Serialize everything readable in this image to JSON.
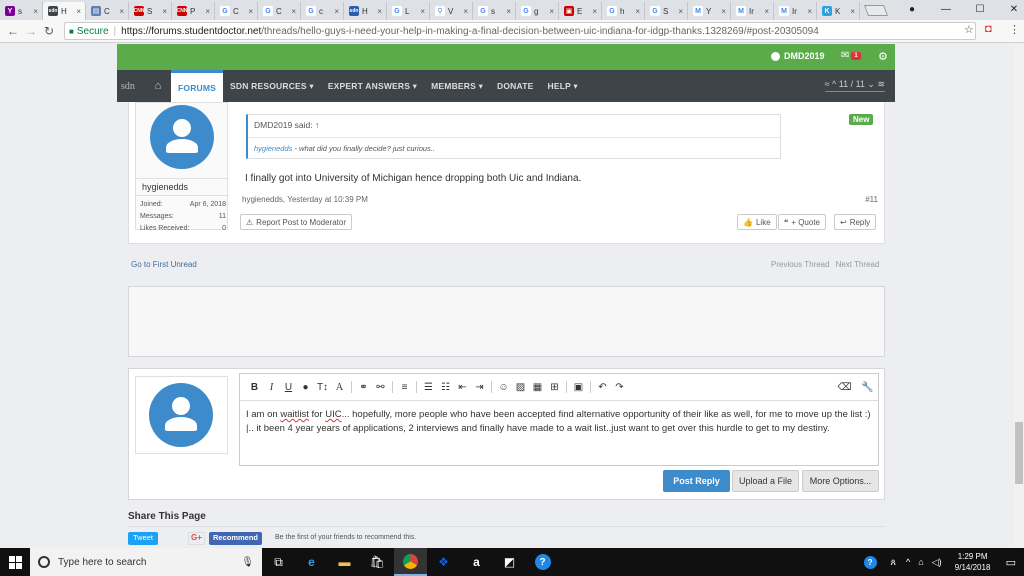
{
  "browser": {
    "tabs": [
      {
        "favicon_text": "Y",
        "favicon_color": "#7b0099",
        "label": "s",
        "close": "×"
      },
      {
        "favicon_text": "sdn",
        "favicon_color": "#3e4447",
        "label": "H",
        "close": "×",
        "active": true
      },
      {
        "favicon_text": "▤",
        "favicon_color": "#5b7fb5",
        "label": "C",
        "close": "×"
      },
      {
        "favicon_text": "CNN",
        "favicon_color": "#cc0000",
        "label": "S",
        "close": "×"
      },
      {
        "favicon_text": "CNN",
        "favicon_color": "#cc0000",
        "label": "P",
        "close": "×"
      },
      {
        "favicon_text": "G",
        "favicon_color": "#ffffff",
        "label": "C",
        "close": "×"
      },
      {
        "favicon_text": "G",
        "favicon_color": "#ffffff",
        "label": "C",
        "close": "×"
      },
      {
        "favicon_text": "G",
        "favicon_color": "#ffffff",
        "label": "c",
        "close": "×"
      },
      {
        "favicon_text": "sdn",
        "favicon_color": "#2a5db0",
        "label": "H",
        "close": "×"
      },
      {
        "favicon_text": "G",
        "favicon_color": "#ffffff",
        "label": "L",
        "close": "×"
      },
      {
        "favicon_text": "⚲",
        "favicon_color": "#ffffff",
        "label": "V",
        "close": "×"
      },
      {
        "favicon_text": "G",
        "favicon_color": "#ffffff",
        "label": "s",
        "close": "×"
      },
      {
        "favicon_text": "G",
        "favicon_color": "#ffffff",
        "label": "g",
        "close": "×"
      },
      {
        "favicon_text": "▣",
        "favicon_color": "#cc0000",
        "label": "E",
        "close": "×"
      },
      {
        "favicon_text": "G",
        "favicon_color": "#ffffff",
        "label": "h",
        "close": "×"
      },
      {
        "favicon_text": "G",
        "favicon_color": "#ffffff",
        "label": "S",
        "close": "×"
      },
      {
        "favicon_text": "M",
        "favicon_color": "#ffffff",
        "label": "Y",
        "close": "×"
      },
      {
        "favicon_text": "M",
        "favicon_color": "#ffffff",
        "label": "Ir",
        "close": "×"
      },
      {
        "favicon_text": "M",
        "favicon_color": "#ffffff",
        "label": "Ir",
        "close": "×"
      },
      {
        "favicon_text": "K",
        "favicon_color": "#2aa3e0",
        "label": "K",
        "close": "×"
      }
    ],
    "window_controls": {
      "profile": "●",
      "minimize": "—",
      "maximize": "☐",
      "close": "✕"
    },
    "address": {
      "back": "←",
      "forward": "→",
      "reload": "↻",
      "lock": "🔒",
      "secure": "Secure",
      "sep": "|",
      "url_domain": "https://forums.studentdoctor.net",
      "url_path": "/threads/hello-guys-i-need-your-help-in-making-a-final-decision-between-uic-indiana-for-idgp-thanks.1328269/#post-20305094",
      "star": "☆",
      "ext": "◘",
      "menu": "⋮"
    }
  },
  "site": {
    "topbar": {
      "username": "DMD2019",
      "mail_icon": "✉",
      "mail_count": "1",
      "gear": "⚙"
    },
    "nav": {
      "logo": "sdn",
      "home": "⌂",
      "items": [
        "FORUMS",
        "SDN RESOURCES ▾",
        "EXPERT ANSWERS ▾",
        "MEMBERS ▾",
        "DONATE",
        "HELP ▾"
      ],
      "pager": "≈ ^ 11 / 11 ⌄ ≋"
    },
    "post": {
      "username": "hygienedds",
      "stats": [
        {
          "label": "Joined:",
          "value": "Apr 6, 2018"
        },
        {
          "label": "Messages:",
          "value": "11"
        },
        {
          "label": "Likes Received:",
          "value": "0"
        }
      ],
      "quote_header": "DMD2019 said: ↑",
      "quote_user": "hygienedds",
      "quote_text": " - what did you finally decide? just curious..",
      "new_badge": "New",
      "message": "I finally got into University of Michigan hence dropping both Uic and Indiana.",
      "meta": "hygienedds, Yesterday at 10:39 PM",
      "number": "#11",
      "report": "Report Post to Moderator",
      "like": "Like",
      "quote": "+ Quote",
      "reply": "Reply"
    },
    "links": {
      "first_unread": "Go to First Unread",
      "previous": "Previous Thread",
      "next": "Next Thread"
    },
    "editor": {
      "text_before": "I am on ",
      "text_wl": "waitlist",
      "text_mid": " for ",
      "text_uic": "UIC",
      "text_after": "... hopefully, more people who have been accepted find alternative opportunity of their like as well, for me to move up the list :) |.. it been 4 year years of applications, 2 interviews and finally have made to a wait list..just want to get over this hurdle to get to my destiny."
    },
    "buttons": {
      "post_reply": "Post Reply",
      "upload": "Upload a File",
      "more": "More Options..."
    },
    "share": {
      "title": "Share This Page",
      "tweet": "Tweet",
      "gplus": "G+",
      "recommend": "Recommend",
      "fb_text": "Be the first of your friends to recommend this."
    }
  },
  "taskbar": {
    "search_placeholder": "Type here to search",
    "time": "1:29 PM",
    "date": "9/14/2018"
  },
  "colors": {
    "brand_green": "#5bab4a",
    "nav_dark": "#3e4447",
    "accent_blue": "#3d8bca"
  }
}
